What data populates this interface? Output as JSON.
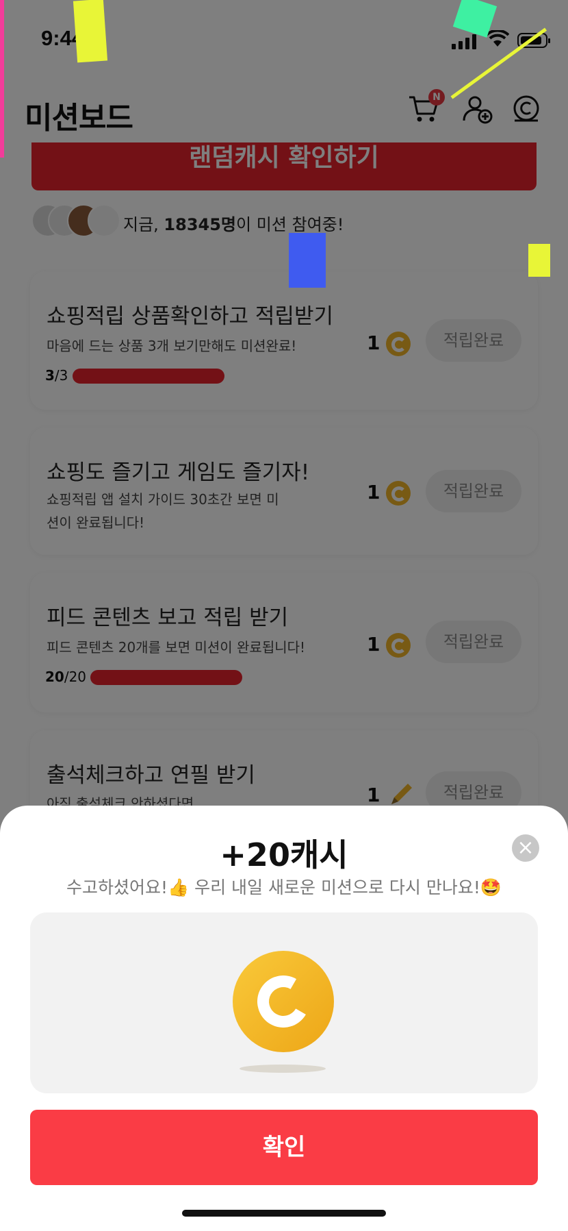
{
  "status_bar": {
    "time": "9:44"
  },
  "header": {
    "title": "미션보드",
    "cart_badge": "N"
  },
  "banner": {
    "label": "랜덤캐시 확인하기"
  },
  "participants": {
    "prefix": "지금, ",
    "count": "18345명",
    "suffix": "이 미션 참여중!"
  },
  "missions": [
    {
      "title": "쇼핑적립 상품확인하고 적립받기",
      "description": "마음에 드는 상품 3개 보기만해도 미션완료!",
      "progress_done": "3",
      "progress_total": "/3",
      "progress": 1.0,
      "reward": "1",
      "reward_icon": "coin-icon",
      "button": "적립완료"
    },
    {
      "title": "쇼핑도 즐기고 게임도 즐기자!",
      "description": "쇼핑적립 앱 설치 가이드 30초간 보면 미션이 완료됩니다!",
      "reward": "1",
      "reward_icon": "coin-icon",
      "button": "적립완료"
    },
    {
      "title": "피드 콘텐츠 보고 적립 받기",
      "description": "피드 콘텐츠 20개를 보면 미션이 완료됩니다!",
      "progress_done": "20",
      "progress_total": "/20",
      "progress": 1.0,
      "reward": "1",
      "reward_icon": "coin-icon",
      "button": "적립완료"
    },
    {
      "title": "출석체크하고 연필 받기",
      "description": "아직 출석체크 안하셨다면",
      "reward": "1",
      "reward_icon": "pencil-icon",
      "button": "적립완료"
    }
  ],
  "sheet": {
    "title": "+20캐시",
    "subtitle": "수고하셨어요!👍 우리 내일 새로운 미션으로 다시 만나요!🤩",
    "confirm_label": "확인"
  },
  "colors": {
    "accent": "#fa3c45",
    "banner": "#e7232c",
    "coin": "#f0b429"
  }
}
